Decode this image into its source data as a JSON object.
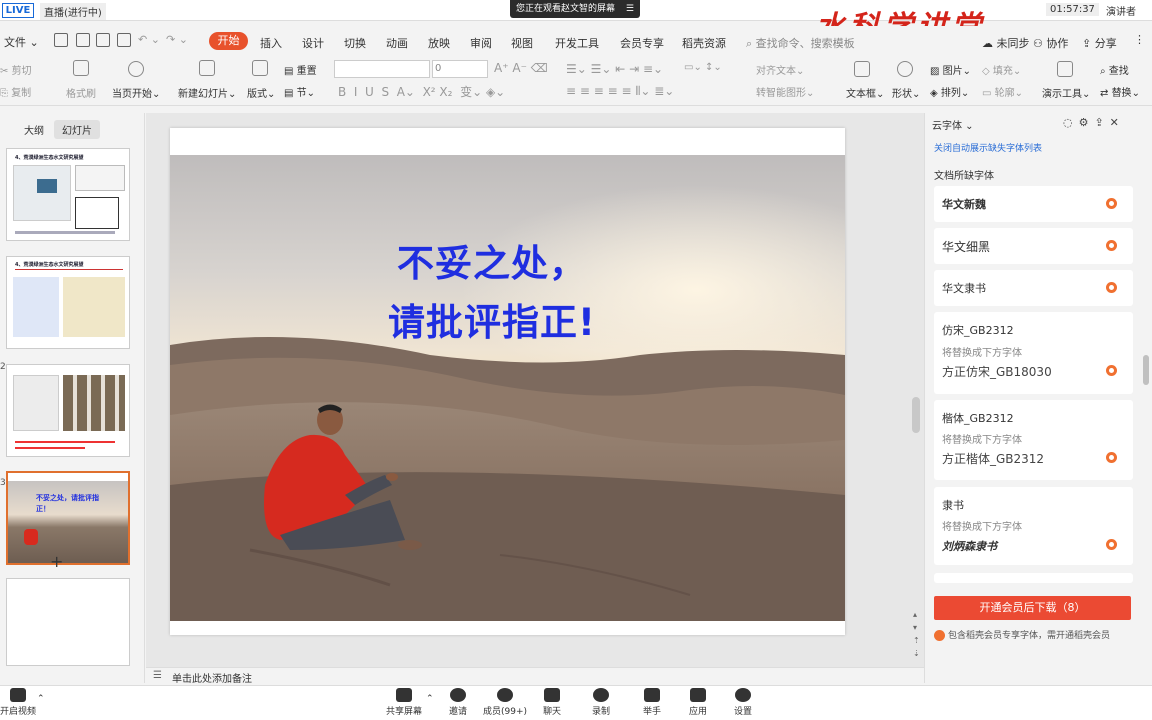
{
  "top": {
    "live": "LIVE",
    "live_status": "直播(进行中)",
    "watch_banner": "您正在观看赵文智的屏幕",
    "watermark": "水科学讲堂",
    "clock": "01:57:37",
    "presenter": "演讲者"
  },
  "menu": {
    "file": "文件",
    "tabs": [
      "开始",
      "插入",
      "设计",
      "切换",
      "动画",
      "放映",
      "审阅",
      "视图",
      "开发工具",
      "会员专享",
      "稻壳资源"
    ],
    "search": "查找命令、搜索模板",
    "sync": "未同步",
    "collab": "协作",
    "share": "分享"
  },
  "ribbon": {
    "cut": "剪切",
    "copy": "复制",
    "format_painter": "格式刷",
    "play_from_current": "当页开始",
    "new_slide": "新建幻灯片",
    "layout": "版式",
    "reset": "重置",
    "section": "节",
    "font_size": "0",
    "text_direction": "对齐文本",
    "smartart": "转智能图形",
    "textbox": "文本框",
    "shape": "形状",
    "picture": "图片",
    "fill": "填充",
    "arrange": "排列",
    "outline": "轮廓",
    "presentation_tools": "演示工具",
    "find": "查找",
    "replace": "替换"
  },
  "left_panel": {
    "tab_outline": "大纲",
    "tab_slides": "幻灯片",
    "thumbs": [
      {
        "num": "",
        "caption": "4、荒漠绿洲生态水文研究展望"
      },
      {
        "num": "",
        "caption": "4、荒漠绿洲生态水文研究展望"
      },
      {
        "num": "2",
        "caption": ""
      },
      {
        "num": "3",
        "caption": "不妥之处，请批评指正！"
      }
    ]
  },
  "slide": {
    "line1": "不妥之处，",
    "line2": "请批评指正!"
  },
  "notes_placeholder": "单击此处添加备注",
  "right_panel": {
    "title": "云字体",
    "link": "关闭自动展示缺失字体列表",
    "section": "文档所缺字体",
    "replace_label": "将替换成下方字体",
    "fonts": [
      {
        "name": "华文新魏"
      },
      {
        "name": "华文细黑"
      },
      {
        "name": "华文隶书"
      },
      {
        "name": "仿宋_GB2312",
        "replacement": "方正仿宋_GB18030"
      },
      {
        "name": "楷体_GB2312",
        "replacement": "方正楷体_GB2312"
      },
      {
        "name": "隶书",
        "replacement": "刘炳森隶书"
      }
    ],
    "download_button": "开通会员后下载（8）",
    "download_note": "包含稻壳会员专享字体，需开通稻壳会员"
  },
  "bottom_bar": {
    "video": "开启视频",
    "items": [
      "共享屏幕",
      "邀请",
      "成员(99+)",
      "聊天",
      "录制",
      "举手",
      "应用",
      "设置"
    ]
  }
}
